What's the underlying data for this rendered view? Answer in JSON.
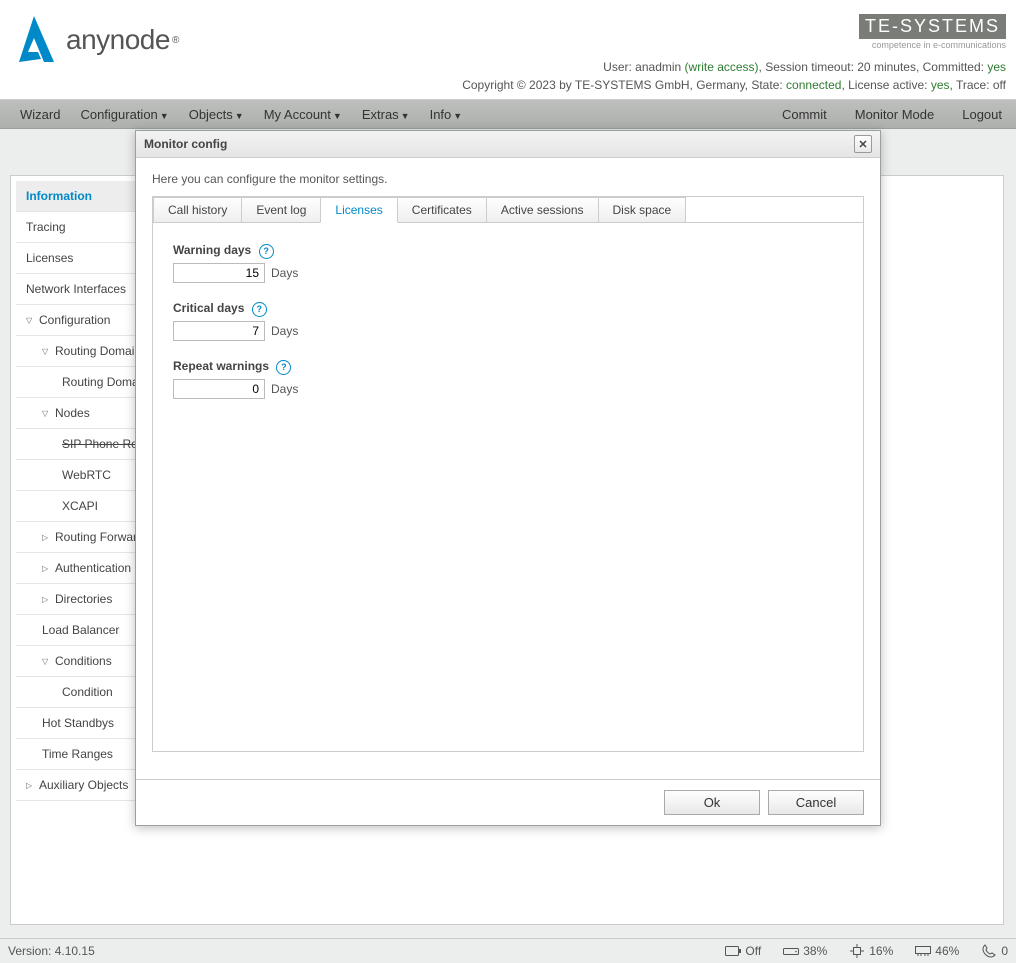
{
  "logo": {
    "brand": "anynode",
    "regmark": "®"
  },
  "vendor": {
    "logo_text": "TE-SYSTEMS",
    "tagline": "competence in e-communications"
  },
  "status1": {
    "user_label": "User: ",
    "user": "anadmin",
    "access": " (write access)",
    "session": ", Session timeout: 20 minutes, Committed: ",
    "committed": "yes"
  },
  "status2": {
    "prefix": "Copyright © 2023 by TE-SYSTEMS GmbH, Germany, State: ",
    "state": "connected",
    "mid": ", License active: ",
    "license": "yes",
    "trace": ", Trace: off"
  },
  "menu": {
    "wizard": "Wizard",
    "configuration": "Configuration",
    "objects": "Objects",
    "my_account": "My Account",
    "extras": "Extras",
    "info": "Info",
    "commit": "Commit",
    "monitor_mode": "Monitor Mode",
    "logout": "Logout"
  },
  "sidebar": {
    "items": [
      {
        "label": "Information",
        "active": true
      },
      {
        "label": "Tracing"
      },
      {
        "label": "Licenses"
      },
      {
        "label": "Network Interfaces"
      },
      {
        "label": "Configuration",
        "tri": "down"
      },
      {
        "label": "Routing Domains",
        "indent": 1,
        "tri": "down"
      },
      {
        "label": "Routing Domain",
        "indent": 2
      },
      {
        "label": "Nodes",
        "indent": 1,
        "tri": "down"
      },
      {
        "label": "SIP Phone Registrar",
        "indent": 2,
        "struck": true
      },
      {
        "label": "WebRTC",
        "indent": 2
      },
      {
        "label": "XCAPI",
        "indent": 2
      },
      {
        "label": "Routing Forward Profiles",
        "indent": 1,
        "tri": "right"
      },
      {
        "label": "Authentication",
        "indent": 1,
        "tri": "right"
      },
      {
        "label": "Directories",
        "indent": 1,
        "tri": "right"
      },
      {
        "label": "Load Balancer",
        "indent": 1
      },
      {
        "label": "Conditions",
        "indent": 1,
        "tri": "down"
      },
      {
        "label": "Condition",
        "indent": 2
      },
      {
        "label": "Hot Standbys",
        "indent": 1
      },
      {
        "label": "Time Ranges",
        "indent": 1
      },
      {
        "label": "Auxiliary Objects",
        "tri": "right"
      }
    ]
  },
  "dialog": {
    "title": "Monitor config",
    "description": "Here you can configure the monitor settings.",
    "tabs": {
      "call_history": "Call history",
      "event_log": "Event log",
      "licenses": "Licenses",
      "certificates": "Certificates",
      "active_sessions": "Active sessions",
      "disk_space": "Disk space"
    },
    "fields": {
      "warning_label": "Warning days",
      "warning_value": "15",
      "critical_label": "Critical days",
      "critical_value": "7",
      "repeat_label": "Repeat warnings",
      "repeat_value": "0",
      "unit": "Days"
    },
    "ok": "Ok",
    "cancel": "Cancel"
  },
  "statusbar": {
    "version_label": "Version: ",
    "version": "4.10.15",
    "battery": "Off",
    "disk": "38%",
    "cpu": "16%",
    "mem": "46%",
    "calls": "0"
  }
}
